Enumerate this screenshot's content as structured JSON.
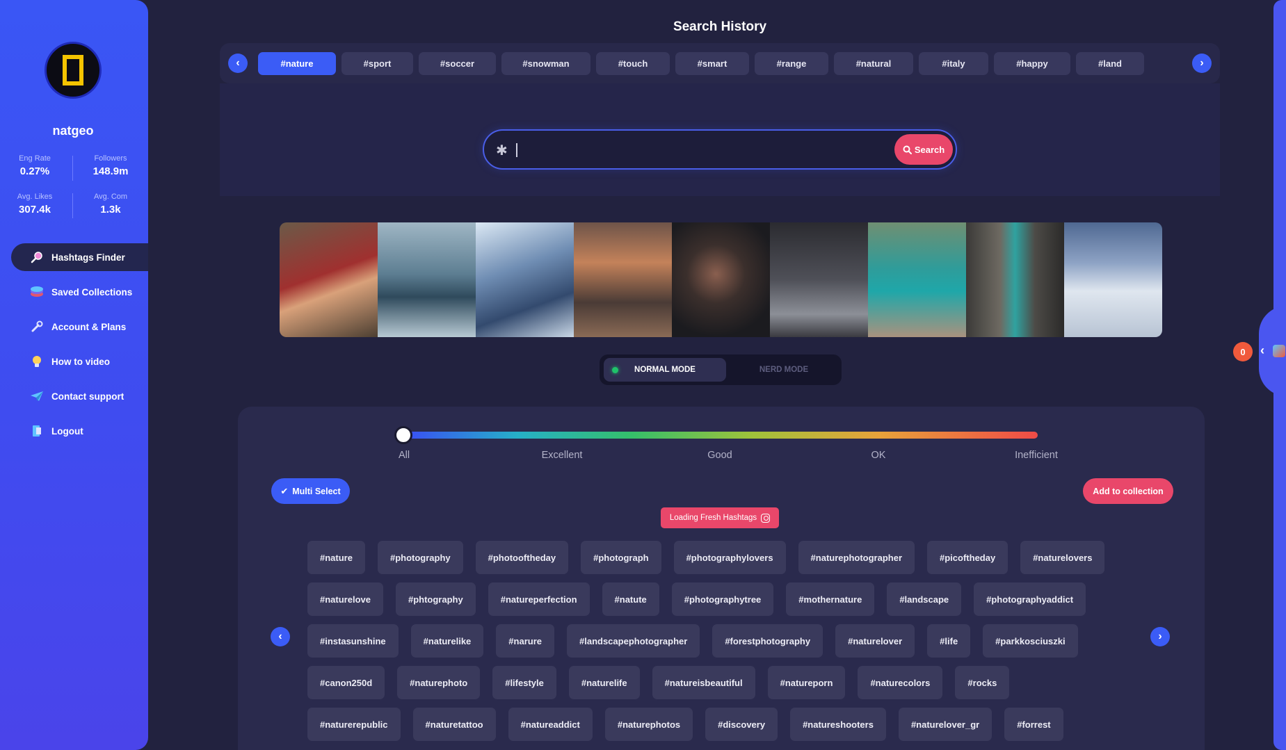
{
  "profile": {
    "name": "natgeo",
    "stats": [
      {
        "label": "Eng Rate",
        "value": "0.27%"
      },
      {
        "label": "Followers",
        "value": "148.9m"
      },
      {
        "label": "Avg. Likes",
        "value": "307.4k"
      },
      {
        "label": "Avg. Com",
        "value": "1.3k"
      }
    ]
  },
  "sidebar": {
    "items": [
      {
        "label": "Hashtags Finder",
        "icon": "magnifier-icon",
        "active": true
      },
      {
        "label": "Saved Collections",
        "icon": "stack-icon"
      },
      {
        "label": "Account & Plans",
        "icon": "wrench-icon"
      },
      {
        "label": "How to video",
        "icon": "bulb-icon"
      },
      {
        "label": "Contact support",
        "icon": "paper-plane-icon"
      },
      {
        "label": "Logout",
        "icon": "logout-icon"
      }
    ]
  },
  "header": {
    "title": "Search History"
  },
  "history": {
    "tags": [
      "#nature",
      "#sport",
      "#soccer",
      "#snowman",
      "#touch",
      "#smart",
      "#range",
      "#natural",
      "#italy",
      "#happy",
      "#land"
    ],
    "active_index": 0
  },
  "search": {
    "value": "",
    "button_label": "Search"
  },
  "modes": {
    "normal": "NORMAL MODE",
    "nerd": "NERD MODE"
  },
  "slider": {
    "labels": [
      "All",
      "Excellent",
      "Good",
      "OK",
      "Inefficient"
    ],
    "selected": "All"
  },
  "actions": {
    "multi_select": "Multi Select",
    "add_collection": "Add to collection",
    "loading": "Loading Fresh Hashtags"
  },
  "tag_rows": [
    [
      "#nature",
      "#photography",
      "#photooftheday",
      "#photograph",
      "#photographylovers",
      "#naturephotographer",
      "#picoftheday",
      "#naturelovers"
    ],
    [
      "#naturelove",
      "#phtography",
      "#natureperfection",
      "#natute",
      "#photographytree",
      "#mothernature",
      "#landscape",
      "#photographyaddict"
    ],
    [
      "#instasunshine",
      "#naturelike",
      "#narure",
      "#landscapephotographer",
      "#forestphotography",
      "#naturelover",
      "#life",
      "#parkkosciuszki"
    ],
    [
      "#canon250d",
      "#naturephoto",
      "#lifestyle",
      "#naturelife",
      "#natureisbeautiful",
      "#natureporn",
      "#naturecolors",
      "#rocks"
    ],
    [
      "#naturerepublic",
      "#naturetattoo",
      "#natureaddict",
      "#naturephotos",
      "#discovery",
      "#natureshooters",
      "#naturelover_gr",
      "#forrest"
    ]
  ],
  "notifications": {
    "count": "0"
  }
}
